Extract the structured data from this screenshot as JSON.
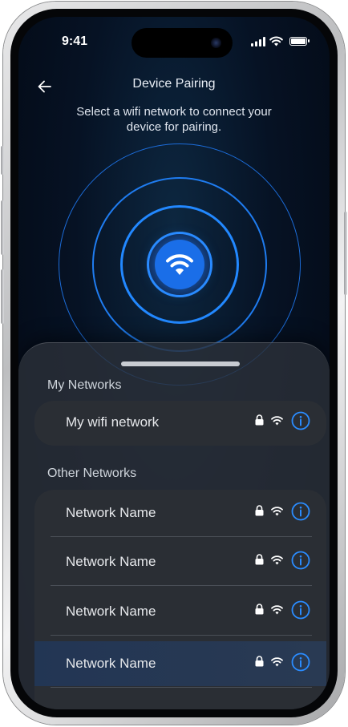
{
  "status_bar": {
    "time": "9:41"
  },
  "header": {
    "title": "Device Pairing",
    "subtitle": "Select a wifi network to connect your device for pairing."
  },
  "my_networks": {
    "label": "My Networks",
    "items": [
      {
        "name": "My wifi network"
      }
    ]
  },
  "other_networks": {
    "label": "Other Networks",
    "items": [
      {
        "name": "Network Name"
      },
      {
        "name": "Network Name"
      },
      {
        "name": "Network Name"
      },
      {
        "name": "Network Name"
      }
    ]
  },
  "colors": {
    "accent": "#2288ff",
    "sheet": "#2b3038",
    "background": "#061224"
  },
  "icons": [
    "back-arrow-icon",
    "wifi-icon",
    "lock-icon",
    "info-icon",
    "signal-icon",
    "battery-icon"
  ]
}
